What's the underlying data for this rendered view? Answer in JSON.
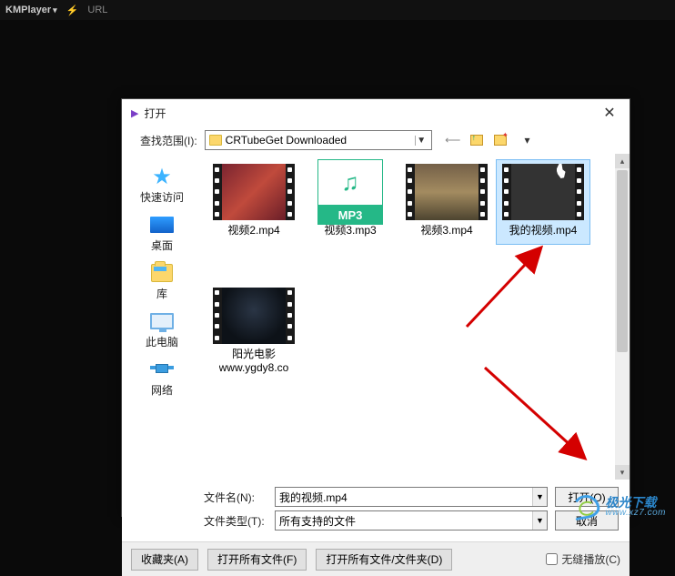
{
  "topbar": {
    "brand": "KMPlayer",
    "url_label": "URL",
    "lightning": "⚡"
  },
  "dialog": {
    "title": "打开",
    "search_label": "查找范围(I):",
    "folder_name": "CRTubeGet Downloaded",
    "close_glyph": "✕",
    "back_glyph": "⟵",
    "view_chev": "▾"
  },
  "sidebar": {
    "items": [
      {
        "label": "快速访问"
      },
      {
        "label": "桌面"
      },
      {
        "label": "库"
      },
      {
        "label": "此电脑"
      },
      {
        "label": "网络"
      }
    ]
  },
  "files": {
    "items": [
      {
        "name": "视频2.mp4"
      },
      {
        "name": "视频3.mp3",
        "mp3_label": "MP3",
        "note_glyph": "♫"
      },
      {
        "name": "视频3.mp4"
      },
      {
        "name": "我的视频.mp4",
        "selected": true
      },
      {
        "name": "阳光电影\nwww.ygdy8.co"
      }
    ]
  },
  "inputs": {
    "filename_label": "文件名(N):",
    "filename_value": "我的视频.mp4",
    "filetype_label": "文件类型(T):",
    "filetype_value": "所有支持的文件",
    "open_btn": "打开(O)",
    "cancel_btn": "取消"
  },
  "footer": {
    "fav_btn": "收藏夹(A)",
    "open_all_btn": "打开所有文件(F)",
    "open_all_folders_btn": "打开所有文件/文件夹(D)",
    "seamless_label": "无缝播放(C)"
  },
  "watermark": {
    "zh": "极光下载",
    "en": "www.xz7.com"
  },
  "scroll": {
    "up": "▴",
    "down": "▾"
  }
}
